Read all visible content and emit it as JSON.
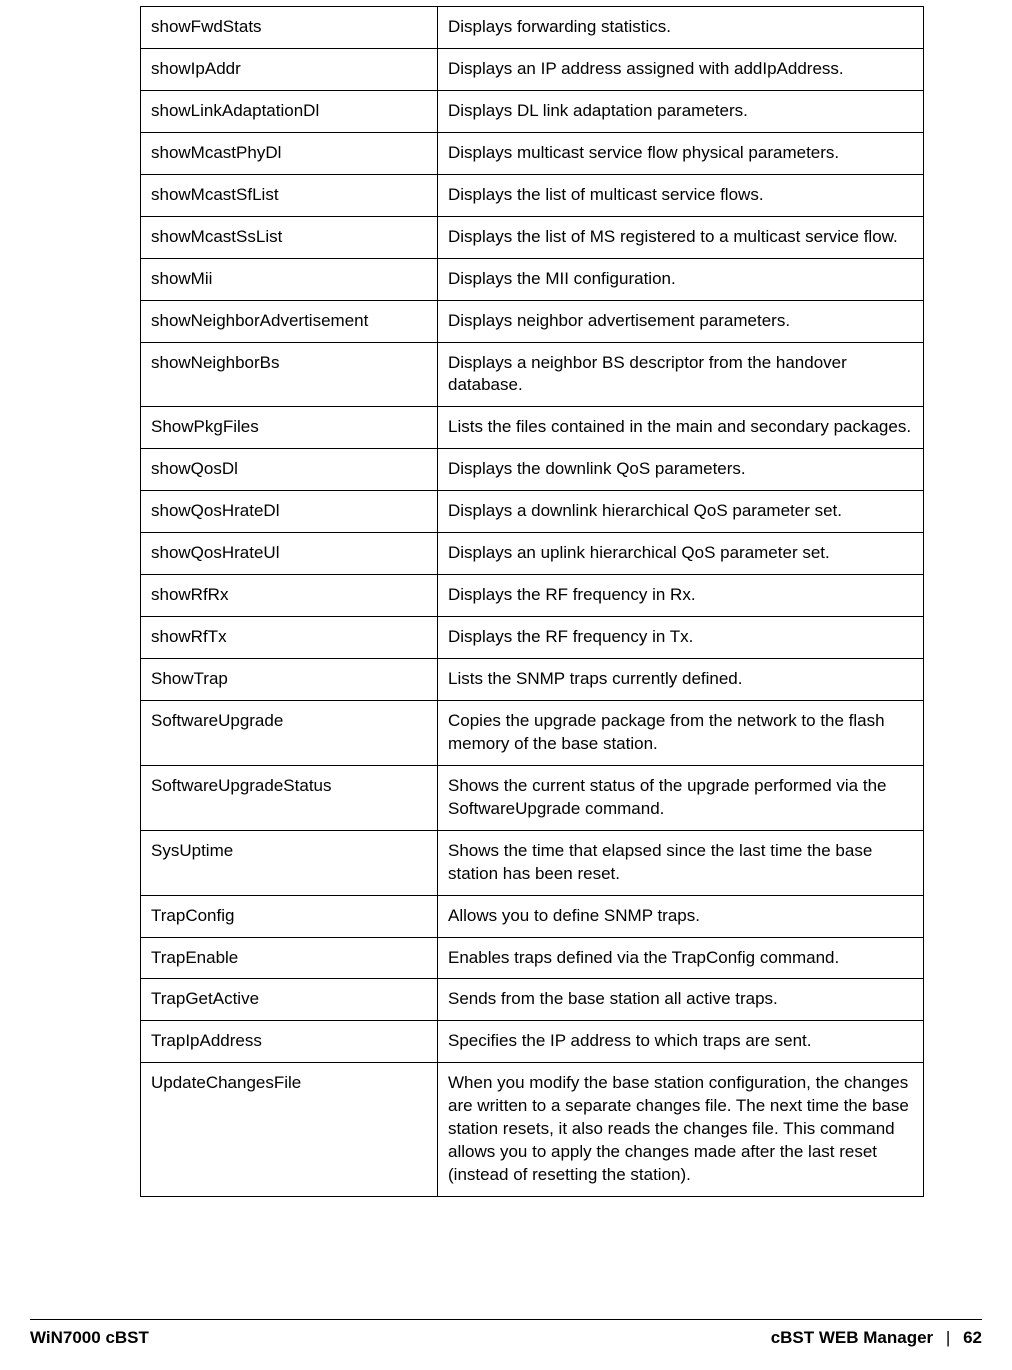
{
  "table": {
    "rows": [
      {
        "cmd": "showFwdStats",
        "desc": "Displays forwarding statistics."
      },
      {
        "cmd": "showIpAddr",
        "desc": "Displays an IP address assigned with addIpAddress."
      },
      {
        "cmd": "showLinkAdaptationDl",
        "desc": "Displays DL link adaptation parameters."
      },
      {
        "cmd": "showMcastPhyDl",
        "desc": "Displays multicast service flow physical parameters."
      },
      {
        "cmd": "showMcastSfList",
        "desc": "Displays the list of multicast service flows."
      },
      {
        "cmd": "showMcastSsList",
        "desc": "Displays the list of MS registered to a multicast service flow."
      },
      {
        "cmd": "showMii",
        "desc": "Displays the MII configuration."
      },
      {
        "cmd": "showNeighborAdvertisement",
        "desc": "Displays neighbor advertisement parameters."
      },
      {
        "cmd": "showNeighborBs",
        "desc": "Displays a neighbor BS descriptor from the handover database."
      },
      {
        "cmd": "ShowPkgFiles",
        "desc": "Lists the files contained in the main and secondary packages."
      },
      {
        "cmd": "showQosDl",
        "desc": "Displays the downlink QoS parameters."
      },
      {
        "cmd": "showQosHrateDl",
        "desc": "Displays a downlink hierarchical QoS parameter set."
      },
      {
        "cmd": "showQosHrateUl",
        "desc": "Displays an uplink hierarchical QoS parameter set."
      },
      {
        "cmd": "showRfRx",
        "desc": "Displays the RF frequency in Rx."
      },
      {
        "cmd": "showRfTx",
        "desc": "Displays the RF frequency in Tx."
      },
      {
        "cmd": "ShowTrap",
        "desc": "Lists the SNMP traps currently defined."
      },
      {
        "cmd": "SoftwareUpgrade",
        "desc": "Copies the upgrade package from the network to the flash memory of the base station."
      },
      {
        "cmd": "SoftwareUpgradeStatus",
        "desc": "Shows the current status of the upgrade performed via the SoftwareUpgrade command."
      },
      {
        "cmd": "SysUptime",
        "desc": "Shows the time that elapsed since the last time the base station has been reset."
      },
      {
        "cmd": "TrapConfig",
        "desc": "Allows you to define SNMP traps."
      },
      {
        "cmd": "TrapEnable",
        "desc": "Enables traps defined via the TrapConfig command."
      },
      {
        "cmd": "TrapGetActive",
        "desc": "Sends from the base station all active traps."
      },
      {
        "cmd": "TrapIpAddress",
        "desc": "Specifies the IP address to which traps are sent."
      },
      {
        "cmd": "UpdateChangesFile",
        "desc": "When you modify the base station configuration, the changes are written to a separate changes file. The next time the base station resets, it also reads the changes file. This command allows you to apply the changes made after the last reset (instead of resetting the station)."
      }
    ]
  },
  "footer": {
    "left": "WiN7000 cBST",
    "right_title": "cBST WEB Manager",
    "separator": "|",
    "page": "62"
  }
}
